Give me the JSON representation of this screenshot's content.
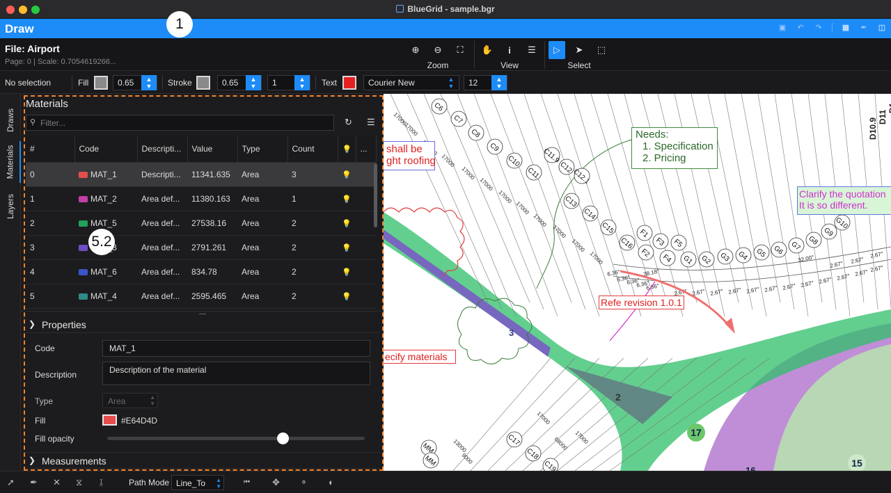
{
  "window": {
    "title": "BlueGrid - sample.bgr"
  },
  "header": {
    "mode": "Draw",
    "callout_1": "1"
  },
  "file": {
    "title": "File: Airport",
    "meta": "Page: 0 | Scale: 0.7054619266..."
  },
  "ribbon": {
    "zoom_label": "Zoom",
    "view_label": "View",
    "select_label": "Select"
  },
  "propbar": {
    "selection": "No selection",
    "fill_label": "Fill",
    "fill_opacity": "0.65",
    "stroke_label": "Stroke",
    "stroke_opacity": "0.65",
    "stroke_width": "1",
    "text_label": "Text",
    "font": "Courier New",
    "font_size": "12"
  },
  "rail": {
    "tabs": [
      "Draws",
      "Materials",
      "Layers"
    ]
  },
  "materials": {
    "title": "Materials",
    "filter_placeholder": "Filter...",
    "columns": [
      "#",
      "Code",
      "Descripti...",
      "Value",
      "Type",
      "Count",
      "..."
    ],
    "rows": [
      {
        "idx": "0",
        "code": "MAT_1",
        "desc": "Descripti...",
        "value": "11341.635",
        "type": "Area",
        "count": "3",
        "color": "#e64d4d"
      },
      {
        "idx": "1",
        "code": "MAT_2",
        "desc": "Area def...",
        "value": "11380.163",
        "type": "Area",
        "count": "1",
        "color": "#c23fa8"
      },
      {
        "idx": "2",
        "code": "MAT_5",
        "desc": "Area def...",
        "value": "27538.16",
        "type": "Area",
        "count": "2",
        "color": "#23a05a"
      },
      {
        "idx": "3",
        "code": "MAT_3",
        "desc": "Area def...",
        "value": "2791.261",
        "type": "Area",
        "count": "2",
        "color": "#6b4fc4"
      },
      {
        "idx": "4",
        "code": "MAT_6",
        "desc": "Area def...",
        "value": "834.78",
        "type": "Area",
        "count": "2",
        "color": "#3b55c9"
      },
      {
        "idx": "5",
        "code": "MAT_4",
        "desc": "Area def...",
        "value": "2595.465",
        "type": "Area",
        "count": "2",
        "color": "#2f8b8b"
      }
    ],
    "callout": "5.2"
  },
  "properties": {
    "header": "Properties",
    "code_label": "Code",
    "code": "MAT_1",
    "desc_label": "Description",
    "desc": "Description of the material",
    "type_label": "Type",
    "type": "Area",
    "fill_label": "Fill",
    "fill_hex": "#E64D4D",
    "opacity_label": "Fill opacity",
    "opacity": 0.68
  },
  "measurements": {
    "header": "Measurements"
  },
  "bottom": {
    "path_mode_label": "Path Mode",
    "path_mode": "Line_To"
  },
  "canvas": {
    "notes": {
      "needs_title": "Needs:",
      "needs_1": "1. Specification",
      "needs_2": "2. Pricing",
      "clarify_1": "Clarify the quotation",
      "clarify_2": "It is so different.",
      "shall_1": "shall be",
      "shall_2": "ght roofing",
      "refe": "Refe revision 1.0.1",
      "specify": "ecify materials"
    },
    "grid_labels": [
      "C6",
      "C7",
      "C8",
      "C9",
      "C10",
      "C11",
      "C11.9",
      "C12",
      "C12.1",
      "C13",
      "C14",
      "C15",
      "C16",
      "F1",
      "F2",
      "F3",
      "F4",
      "F5",
      "G1",
      "G2",
      "G3",
      "G4",
      "G5",
      "G6",
      "G7",
      "G8",
      "G9",
      "G10",
      "C17",
      "C18",
      "C19",
      "MM",
      "MM"
    ],
    "vertical_labels": [
      "D10.9",
      "D11",
      "D1"
    ],
    "dims": [
      "17000",
      "17000",
      "256500",
      "17000",
      "17000",
      "17000",
      "17000",
      "17000",
      "17000",
      "17000",
      "17000",
      "17000",
      "17000",
      "68000",
      "17000",
      "13000",
      "9000"
    ],
    "angles": [
      "6.36°",
      "6.36°",
      "6.36°",
      "6.36°",
      "6.36°",
      "38.18°",
      "2.67°",
      "2.67°",
      "2.67°",
      "2.67°",
      "2.67°",
      "2.67°",
      "2.67°",
      "2.67°",
      "2.67°",
      "2.67°",
      "2.67°",
      "2.67°",
      "32.00°",
      "2.67°",
      "2.67°",
      "2.67°"
    ],
    "region_labels": [
      "3",
      "2",
      "17",
      "15",
      "16"
    ]
  }
}
